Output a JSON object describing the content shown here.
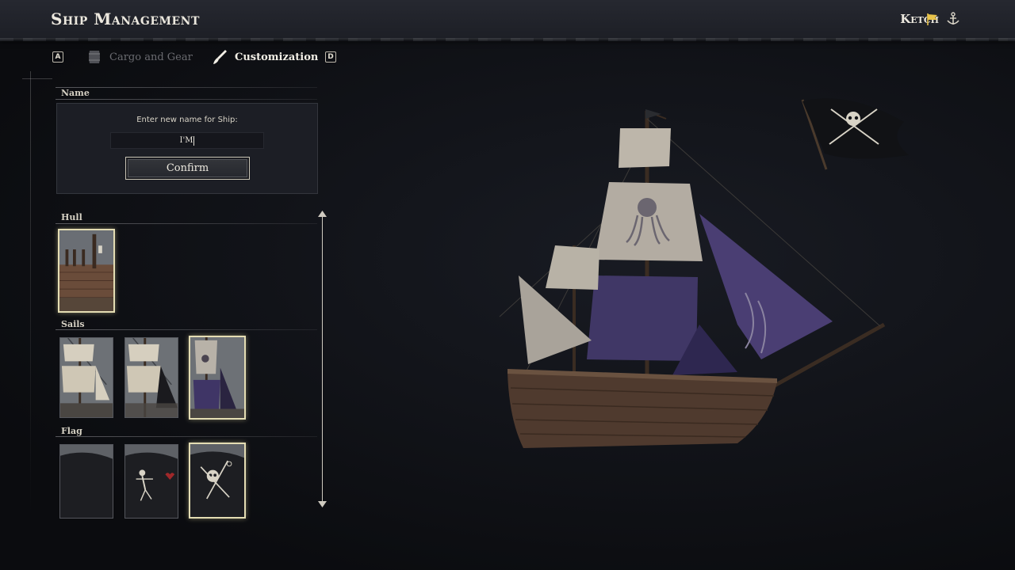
{
  "header": {
    "title": "Ship Management",
    "ship_class": "Ketch",
    "icons": [
      "flag-icon",
      "anchor-icon"
    ],
    "accent_color": "#e8c34a"
  },
  "tabs": {
    "prev_key": "A",
    "next_key": "D",
    "items": [
      {
        "label": "Cargo and Gear",
        "icon": "barrel-icon",
        "active": false
      },
      {
        "label": "Customization",
        "icon": "brush-icon",
        "active": true
      }
    ]
  },
  "name_section": {
    "label": "Name",
    "prompt": "Enter new name for Ship:",
    "input_value": "I'M",
    "confirm_label": "Confirm"
  },
  "hull_section": {
    "label": "Hull",
    "options": [
      {
        "name": "hull-wood",
        "selected": true
      }
    ]
  },
  "sails_section": {
    "label": "Sails",
    "options": [
      {
        "name": "sails-white",
        "selected": false
      },
      {
        "name": "sails-white-black",
        "selected": false
      },
      {
        "name": "sails-purple-kraken",
        "selected": true
      }
    ]
  },
  "flag_section": {
    "label": "Flag",
    "options": [
      {
        "name": "flag-plain-black",
        "selected": false
      },
      {
        "name": "flag-skeleton-heart",
        "selected": false
      },
      {
        "name": "flag-skull-crossed-swords",
        "selected": true
      }
    ]
  },
  "colors": {
    "selected_border": "#e4ddb3",
    "sail_purple": "#4a3e6e",
    "background": "#12141a"
  }
}
